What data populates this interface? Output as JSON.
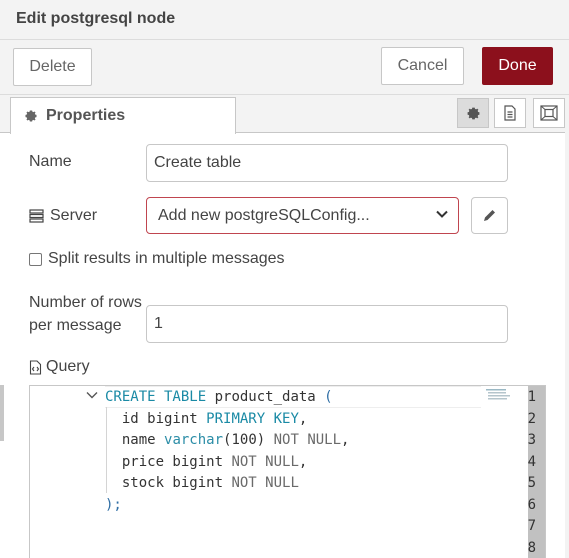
{
  "dialog": {
    "title": "Edit postgresql node"
  },
  "toolbar": {
    "delete_label": "Delete",
    "cancel_label": "Cancel",
    "done_label": "Done",
    "done_color": "#8c101c"
  },
  "tabs": {
    "properties_label": "Properties"
  },
  "form": {
    "name_label": "Name",
    "name_value": "Create table",
    "server_label": "Server",
    "server_value": "Add new postgreSQLConfig...",
    "split_label": "Split results in multiple messages",
    "split_checked": false,
    "rows_label_1": "Number of rows",
    "rows_label_2": "per message",
    "rows_value": "1",
    "query_label": "Query"
  },
  "editor": {
    "line_numbers": [
      "1",
      "2",
      "3",
      "4",
      "5",
      "6",
      "7",
      "8"
    ],
    "lines": [
      [
        {
          "t": "CREATE TABLE",
          "c": "kw"
        },
        {
          "t": " product_data ",
          "c": ""
        },
        {
          "t": "(",
          "c": "pn"
        }
      ],
      [
        {
          "t": "  id bigint ",
          "c": ""
        },
        {
          "t": "PRIMARY KEY",
          "c": "kw"
        },
        {
          "t": ",",
          "c": ""
        }
      ],
      [
        {
          "t": "  name ",
          "c": ""
        },
        {
          "t": "varchar",
          "c": "ty"
        },
        {
          "t": "(100) ",
          "c": ""
        },
        {
          "t": "NOT NULL",
          "c": "nl"
        },
        {
          "t": ",",
          "c": ""
        }
      ],
      [
        {
          "t": "  price bigint ",
          "c": ""
        },
        {
          "t": "NOT NULL",
          "c": "nl"
        },
        {
          "t": ",",
          "c": ""
        }
      ],
      [
        {
          "t": "  stock bigint ",
          "c": ""
        },
        {
          "t": "NOT NULL",
          "c": "nl"
        }
      ],
      [
        {
          "t": ");",
          "c": "pn"
        }
      ],
      [],
      []
    ]
  }
}
